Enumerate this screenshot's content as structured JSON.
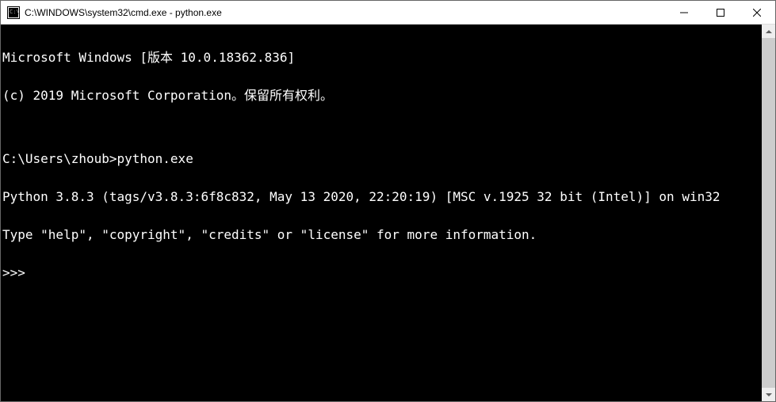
{
  "titlebar": {
    "title": "C:\\WINDOWS\\system32\\cmd.exe - python.exe"
  },
  "terminal": {
    "lines": {
      "l0": "Microsoft Windows [版本 10.0.18362.836]",
      "l1": "(c) 2019 Microsoft Corporation。保留所有权利。",
      "l2": "",
      "l3": "C:\\Users\\zhoub>python.exe",
      "l4": "Python 3.8.3 (tags/v3.8.3:6f8c832, May 13 2020, 22:20:19) [MSC v.1925 32 bit (Intel)] on win32",
      "l5": "Type \"help\", \"copyright\", \"credits\" or \"license\" for more information.",
      "l6": ">>>"
    }
  }
}
